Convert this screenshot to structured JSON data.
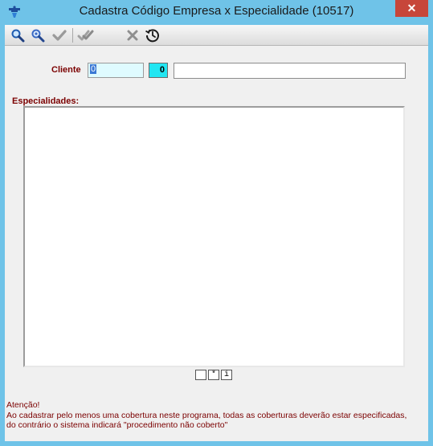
{
  "window": {
    "title": "Cadastra Código Empresa x Especialidade (10517)",
    "close_symbol": "✕"
  },
  "toolbar": {
    "buttons": [
      {
        "name": "search-icon",
        "enabled": true
      },
      {
        "name": "search-next-icon",
        "enabled": true
      },
      {
        "name": "confirm-icon",
        "enabled": false
      },
      {
        "name": "confirm-all-icon",
        "enabled": false
      },
      {
        "name": "cancel-icon",
        "enabled": false
      },
      {
        "name": "history-icon",
        "enabled": true
      }
    ]
  },
  "form": {
    "cliente_label": "Cliente",
    "cliente_code": "0",
    "cliente_id": "0",
    "cliente_name": "",
    "especialidades_label": "Especialidades:"
  },
  "list_nav": {
    "blank": "",
    "star": "*",
    "info": "i"
  },
  "warning": {
    "heading": "Atenção!",
    "line1": "Ao cadastrar pelo menos uma cobertura neste programa, todas as coberturas deverão estar especificadas,",
    "line2": "do contrário o sistema indicará \"procedimento não coberto\""
  },
  "colors": {
    "titlebar": "#6fc3e8",
    "label": "#7b0000",
    "code_field": "#dffbff",
    "id_field": "#22e6f2",
    "close": "#c7463a"
  }
}
